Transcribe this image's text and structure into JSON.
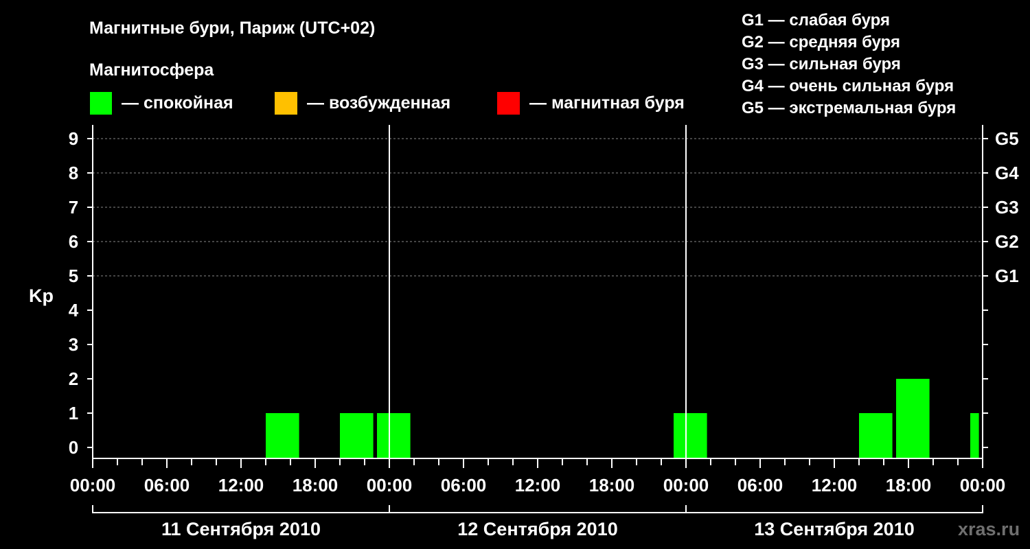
{
  "title": "Магнитные бури, Париж (UTC+02)",
  "legend": {
    "heading": "Магнитосфера",
    "items": [
      {
        "label": "— спокойная",
        "color": "#00ff00"
      },
      {
        "label": "— возбужденная",
        "color": "#ffc000"
      },
      {
        "label": "— магнитная буря",
        "color": "#ff0000"
      }
    ]
  },
  "storm_scale": [
    "G1 — слабая буря",
    "G2 — средняя буря",
    "G3 — сильная буря",
    "G4 — очень сильная буря",
    "G5 — экстремальная буря"
  ],
  "watermark": "xras.ru",
  "chart_data": {
    "type": "bar",
    "ylabel": "Kp",
    "ylim": [
      0,
      9
    ],
    "yticks": [
      0,
      1,
      2,
      3,
      4,
      5,
      6,
      7,
      8,
      9
    ],
    "right_axis_labels": [
      {
        "kp": 5,
        "label": "G1"
      },
      {
        "kp": 6,
        "label": "G2"
      },
      {
        "kp": 7,
        "label": "G3"
      },
      {
        "kp": 8,
        "label": "G4"
      },
      {
        "kp": 9,
        "label": "G5"
      }
    ],
    "xlim_hours": [
      0,
      72
    ],
    "x_tick_labels": [
      {
        "hour": 0,
        "label": "00:00"
      },
      {
        "hour": 6,
        "label": "06:00"
      },
      {
        "hour": 12,
        "label": "12:00"
      },
      {
        "hour": 18,
        "label": "18:00"
      },
      {
        "hour": 24,
        "label": "00:00"
      },
      {
        "hour": 30,
        "label": "06:00"
      },
      {
        "hour": 36,
        "label": "12:00"
      },
      {
        "hour": 42,
        "label": "18:00"
      },
      {
        "hour": 48,
        "label": "00:00"
      },
      {
        "hour": 54,
        "label": "06:00"
      },
      {
        "hour": 60,
        "label": "12:00"
      },
      {
        "hour": 66,
        "label": "18:00"
      },
      {
        "hour": 72,
        "label": "00:00"
      }
    ],
    "days": [
      {
        "label": "11 Сентября 2010",
        "start_hour": 0,
        "end_hour": 24
      },
      {
        "label": "12 Сентября 2010",
        "start_hour": 24,
        "end_hour": 48
      },
      {
        "label": "13 Сентября 2010",
        "start_hour": 48,
        "end_hour": 72
      }
    ],
    "grid": "dashed horizontal at Kp 5–9",
    "bars": [
      {
        "start_hour": 14,
        "end_hour": 16.7,
        "kp": 1,
        "color": "#00ff00"
      },
      {
        "start_hour": 20,
        "end_hour": 22.7,
        "kp": 1,
        "color": "#00ff00"
      },
      {
        "start_hour": 23,
        "end_hour": 25.7,
        "kp": 1,
        "color": "#00ff00"
      },
      {
        "start_hour": 47,
        "end_hour": 49.7,
        "kp": 1,
        "color": "#00ff00"
      },
      {
        "start_hour": 62,
        "end_hour": 64.7,
        "kp": 1,
        "color": "#00ff00"
      },
      {
        "start_hour": 65,
        "end_hour": 67.7,
        "kp": 2,
        "color": "#00ff00"
      },
      {
        "start_hour": 71,
        "end_hour": 71.7,
        "kp": 1,
        "color": "#00ff00"
      }
    ]
  }
}
